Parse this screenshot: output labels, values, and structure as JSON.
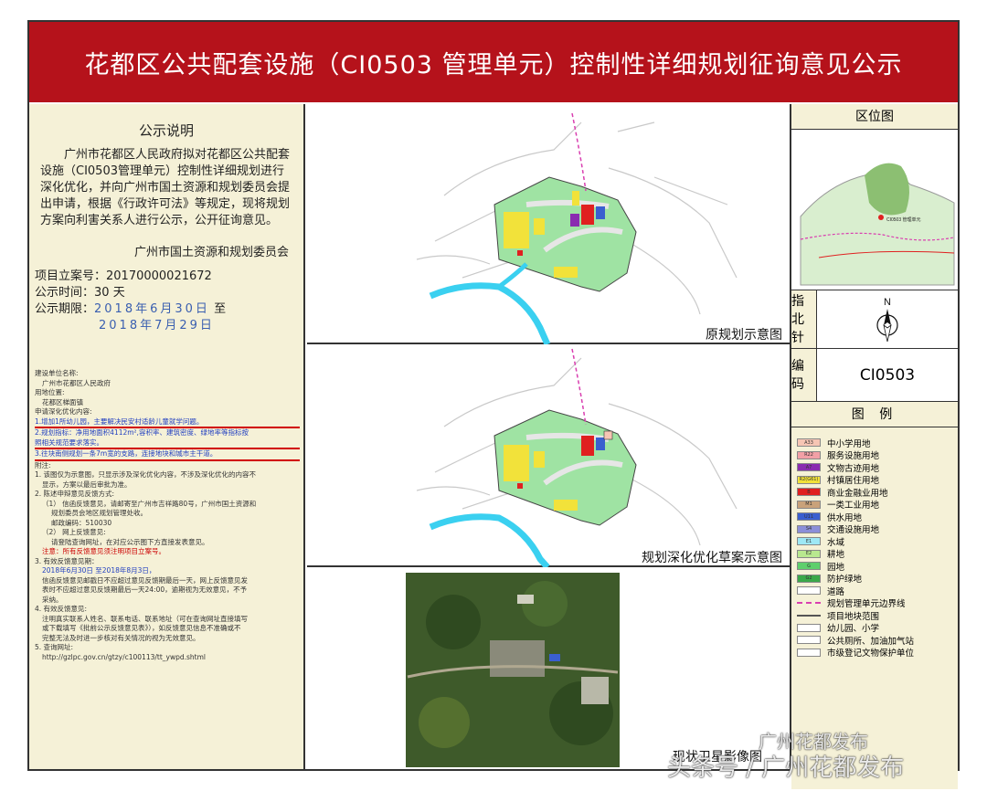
{
  "title": "花都区公共配套设施（CI0503 管理单元）控制性详细规划征询意见公示",
  "left": {
    "heading": "公示说明",
    "intro": "广州市花都区人民政府拟对花都区公共配套设施（CI0503管理单元）控制性详细规划进行深化优化，并向广州市国土资源和规划委员会提出申请，根据《行政许可法》等规定，现将规划方案向利害关系人进行公示，公开征询意见。",
    "org": "广州市国土资源和规划委员会",
    "project_no_label": "项目立案号：",
    "project_no": "20170000021672",
    "duration_label": "公示时间：",
    "duration": "30 天",
    "period_label": "公示期限：",
    "period_start": "2018年6月30日",
    "period_to": "至",
    "period_end": "2018年7月29日",
    "applicant_label": "建设单位名称:",
    "applicant": "广州市花都区人民政府",
    "location_label": "用地位置:",
    "location": "花都区梯面镇",
    "content_label": "申请深化优化内容:",
    "item1": "1.增加1所幼儿园，主要解决民安村适龄儿童就学问题。",
    "item2a": "2.规划指标：净用地面积4112m²,容积率、建筑密度、绿地率等指标按",
    "item2b": "照相关规范要求落实。",
    "item3": "3.往块南侧规划一条7m宽的支路，连接地块和城市主干道。",
    "note_label": "附注:",
    "note1a": "1. 该图仅为示意图，只显示涉及深化优化内容，不涉及深化优化的内容不",
    "note1b": "显示，方案以最后审批为准。",
    "note2": "2. 陈述申辩意见反馈方式:",
    "note2a": "（1） 信函反馈意见，请邮寄至广州市吉祥路80号，广州市国土资源和",
    "note2b": "规划委员会地区规划管理处收。",
    "note2c": "邮政编码：510030",
    "note2d": "（2） 网上反馈意见:",
    "note2e": "请登陆查询网址，在对应公示图下方直接发表意见。",
    "note2f": "注意：所有反馈意见须注明项目立案号。",
    "note3a": "3. 有效反馈意见期：",
    "note3b": "2018年6月30日 至2018年8月3日，",
    "note3c": "信函反馈意见邮戳日不应超过意见反馈期最后一天，网上反馈意见发",
    "note3d": "表时不应超过意见反馈期最后一天24:00，逾期视为无效意见，不予",
    "note3e": "采纳。",
    "note4a": "4. 有效反馈意见:",
    "note4b": "注明真实联系人姓名、联系电话、联系地址（可在查询网址直接填写",
    "note4c": "或下载填写《批前公示反馈意见表》），如反馈意见信息不准确或不",
    "note4d": "完整无法及时进一步核对有关情况的视为无效意见。",
    "note5a": "5. 查询网址:",
    "note5b": "http://gzlpc.gov.cn/gtzy/c100113/tt_ywpd.shtml"
  },
  "panels": {
    "original": "原规划示意图",
    "optimized": "规划深化优化草案示意图",
    "aerial": "现状卫星影像图"
  },
  "right": {
    "location_map_label": "区位图",
    "location_map_marker": "CI0503 管理单元",
    "north_label": "指北针",
    "north_letter": "N",
    "code_label": "编码",
    "code_value": "CI0503",
    "legend_label": "图 例",
    "legend": [
      {
        "code": "A33",
        "label": "中小学用地",
        "color": "#f6c5b4"
      },
      {
        "code": "R22",
        "label": "服务设施用地",
        "color": "#f2a0a6"
      },
      {
        "code": "A7",
        "label": "文物古迹用地",
        "color": "#8a2bb0"
      },
      {
        "code": "R2(G61)",
        "label": "村镇居住用地",
        "color": "#f2e23a"
      },
      {
        "code": "B",
        "label": "商业金融业用地",
        "color": "#e02020"
      },
      {
        "code": "M1",
        "label": "一类工业用地",
        "color": "#c9a27a"
      },
      {
        "code": "U11",
        "label": "供水用地",
        "color": "#3a5fcf"
      },
      {
        "code": "S4",
        "label": "交通设施用地",
        "color": "#8c8fd8"
      },
      {
        "code": "E1",
        "label": "水域",
        "color": "#9ee8f5"
      },
      {
        "code": "E2",
        "label": "耕地",
        "color": "#b8e88f"
      },
      {
        "code": "G",
        "label": "园地",
        "color": "#5ecf6c"
      },
      {
        "code": "G2",
        "label": "防护绿地",
        "color": "#3aa84a"
      },
      {
        "code": "",
        "label": "道路",
        "color": "#ffffff"
      },
      {
        "code": "",
        "label": "规划管理单元边界线",
        "color": "#d93fb0"
      },
      {
        "code": "",
        "label": "项目地块范围",
        "color": "#555555"
      },
      {
        "code": "",
        "label": "幼儿园、小学",
        "color": "#ffffff"
      },
      {
        "code": "",
        "label": "公共厕所、加油加气站",
        "color": "#ffffff"
      },
      {
        "code": "",
        "label": "市级登记文物保护单位",
        "color": "#ffffff"
      }
    ]
  },
  "watermark": {
    "line1": "广州花都发布",
    "line2": "头条号 / 广州花都发布"
  }
}
